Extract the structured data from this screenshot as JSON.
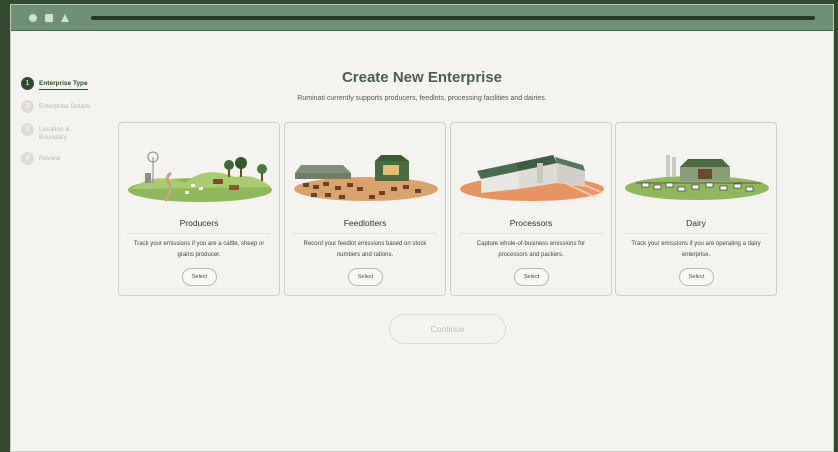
{
  "steps": [
    {
      "num": "1",
      "label": "Enterprise Type"
    },
    {
      "num": "2",
      "label": "Enterprise Details"
    },
    {
      "num": "3",
      "label": "Location & Boundary"
    },
    {
      "num": "4",
      "label": "Review"
    }
  ],
  "page": {
    "title": "Create New Enterprise",
    "subtitle": "Ruminati currently supports producers, feedlots, processing facilities and dairies."
  },
  "cards": [
    {
      "title": "Producers",
      "description": "Track your emissions if you are a cattle, sheep or grains producer.",
      "button": "Select"
    },
    {
      "title": "Feedlotters",
      "description": "Record your feedlot emissions based on stock numbers and rations.",
      "button": "Select"
    },
    {
      "title": "Processors",
      "description": "Capture whole-of-business emissions for processors and packers.",
      "button": "Select"
    },
    {
      "title": "Dairy",
      "description": "Track your emissions if you are operating a dairy enterprise.",
      "button": "Select"
    }
  ],
  "continue_label": "Continue",
  "colors": {
    "brand_dark": "#2f4a2c",
    "titlebar": "#6f9173",
    "background": "#f4f3ef",
    "grass": "#8fb85a",
    "soil": "#d9a36b",
    "processor_ground": "#e9935f"
  },
  "icons": [
    "window-circle-icon",
    "window-square-icon",
    "window-triangle-icon"
  ]
}
